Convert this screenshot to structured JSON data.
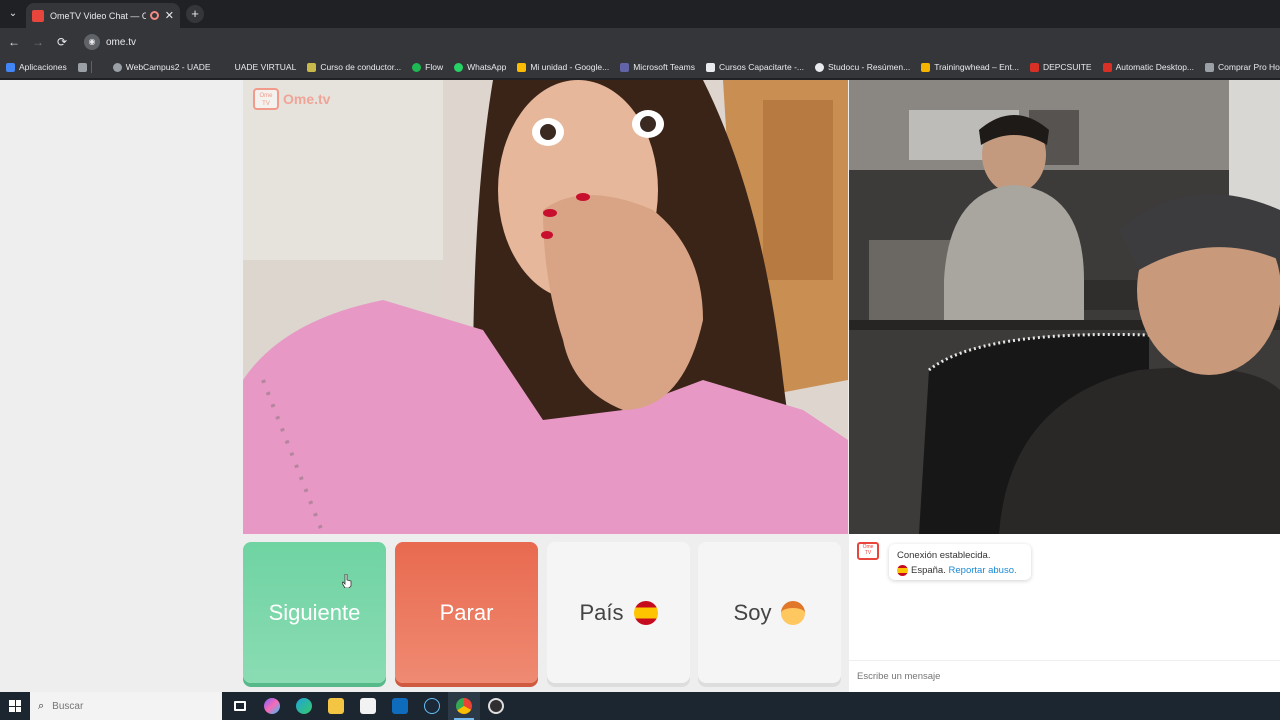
{
  "browser": {
    "tab": {
      "title": "OmeTV Video Chat — Ome",
      "close": "✕"
    },
    "new_tab": "+",
    "nav": {
      "back": "←",
      "forward": "→",
      "reload": "⟳"
    },
    "url": "ome.tv",
    "bookmarks": [
      {
        "label": "Aplicaciones",
        "color": "#4285f4"
      },
      {
        "label": "WebCampus2 - UADE",
        "color": "#9aa0a6"
      },
      {
        "label": "UADE VIRTUAL",
        "color": "#35363a"
      },
      {
        "label": "Curso de conductor...",
        "color": "#c9b84a"
      },
      {
        "label": "Flow",
        "color": "#1db954"
      },
      {
        "label": "WhatsApp",
        "color": "#25d366"
      },
      {
        "label": "Mi unidad - Google...",
        "color": "#fbbc04"
      },
      {
        "label": "Microsoft Teams",
        "color": "#6264a7"
      },
      {
        "label": "Cursos Capacitarte -...",
        "color": "#e8eaed"
      },
      {
        "label": "Studocu - Resúmen...",
        "color": "#e8eaed"
      },
      {
        "label": "Trainingwhead – Ent...",
        "color": "#f4b400"
      },
      {
        "label": "DEPCSUITE",
        "color": "#d93025"
      },
      {
        "label": "Automatic Desktop...",
        "color": "#d93025"
      },
      {
        "label": "Comprar Pro Horm...",
        "color": "#9aa0a6"
      }
    ]
  },
  "ometv": {
    "logo_text": "Ome.tv",
    "logo_badge": "Ome TV",
    "buttons": {
      "next": "Siguiente",
      "stop": "Parar",
      "country": "País",
      "me": "Soy"
    },
    "chat": {
      "status": "Conexión establecida.",
      "country": "España.",
      "report": "Reportar abuso.",
      "placeholder": "Escribe un mensaje"
    }
  },
  "taskbar": {
    "search_placeholder": "Buscar",
    "icons": [
      {
        "name": "task-view-icon",
        "color": "#ffffff"
      },
      {
        "name": "copilot-icon",
        "color": "#7b61ff"
      },
      {
        "name": "edge-icon",
        "color": "#1fa3d8"
      },
      {
        "name": "file-explorer-icon",
        "color": "#f4c542"
      },
      {
        "name": "microsoft-store-icon",
        "color": "#f2f2f2"
      },
      {
        "name": "outlook-icon",
        "color": "#0f6cbd"
      },
      {
        "name": "steam-icon",
        "color": "#1b2838"
      },
      {
        "name": "chrome-icon",
        "color": "#ea4335"
      },
      {
        "name": "obs-icon",
        "color": "#302e31"
      }
    ]
  }
}
